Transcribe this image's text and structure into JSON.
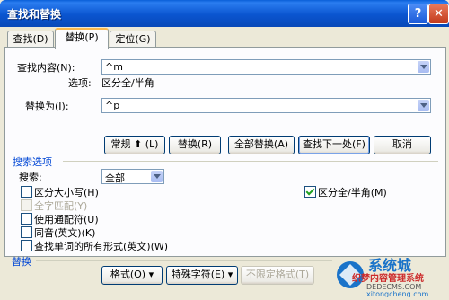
{
  "window": {
    "title": "查找和替换"
  },
  "tabs": [
    {
      "label": "查找(D)"
    },
    {
      "label": "替换(P)"
    },
    {
      "label": "定位(G)"
    }
  ],
  "find": {
    "label": "查找内容(N):",
    "value": "^m",
    "options_label": "选项:",
    "options_value": "区分全/半角"
  },
  "replace": {
    "label": "替换为(I):",
    "value": "^p"
  },
  "buttons": {
    "less": "常规 ⬆ (L)",
    "replace": "替换(R)",
    "replace_all": "全部替换(A)",
    "find_next": "查找下一处(F)",
    "cancel": "取消"
  },
  "search_options": {
    "group_title": "搜索选项",
    "search_label": "搜索:",
    "search_value": "全部",
    "match_case": "区分大小写(H)",
    "whole_word": "全字匹配(Y)",
    "wildcards": "使用通配符(U)",
    "sounds_like": "同音(英文)(K)",
    "all_forms": "查找单词的所有形式(英文)(W)",
    "match_width": "区分全/半角(M)"
  },
  "replace_group": {
    "title": "替换",
    "format": "格式(O) ▾",
    "special": "特殊字符(E) ▾",
    "no_format": "不限定格式(T)"
  },
  "watermark": {
    "brand": "系统城",
    "tagline": "织梦内容管理系统",
    "site1": "DEDECMS.COM",
    "site2": "xitongcheng.com"
  }
}
